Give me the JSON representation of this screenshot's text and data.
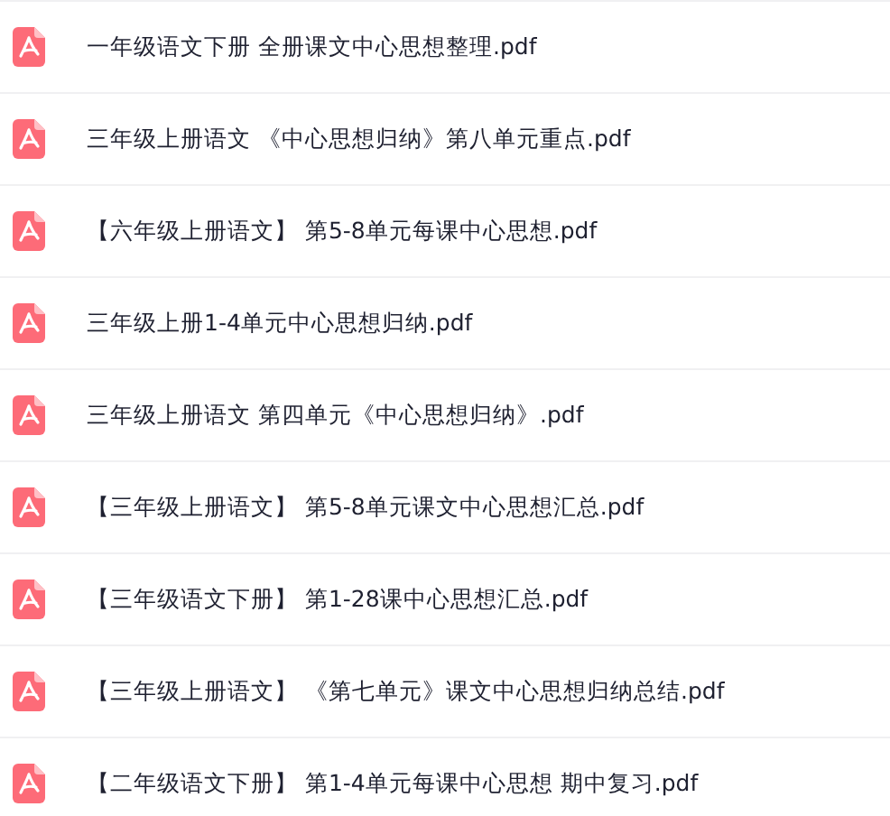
{
  "files": [
    {
      "name": "一年级语文下册 全册课文中心思想整理.pdf",
      "kind": "pdf"
    },
    {
      "name": "三年级上册语文 《中心思想归纳》第八单元重点.pdf",
      "kind": "pdf"
    },
    {
      "name": "【六年级上册语文】 第5-8单元每课中心思想.pdf",
      "kind": "pdf"
    },
    {
      "name": "三年级上册1-4单元中心思想归纳.pdf",
      "kind": "pdf"
    },
    {
      "name": "三年级上册语文 第四单元《中心思想归纳》.pdf",
      "kind": "pdf"
    },
    {
      "name": "【三年级上册语文】 第5-8单元课文中心思想汇总.pdf",
      "kind": "pdf"
    },
    {
      "name": "【三年级语文下册】 第1-28课中心思想汇总.pdf",
      "kind": "pdf"
    },
    {
      "name": "【三年级上册语文】 《第七单元》课文中心思想归纳总结.pdf",
      "kind": "pdf"
    },
    {
      "name": "【二年级语文下册】 第1-4单元每课中心思想 期中复习.pdf",
      "kind": "pdf"
    }
  ]
}
